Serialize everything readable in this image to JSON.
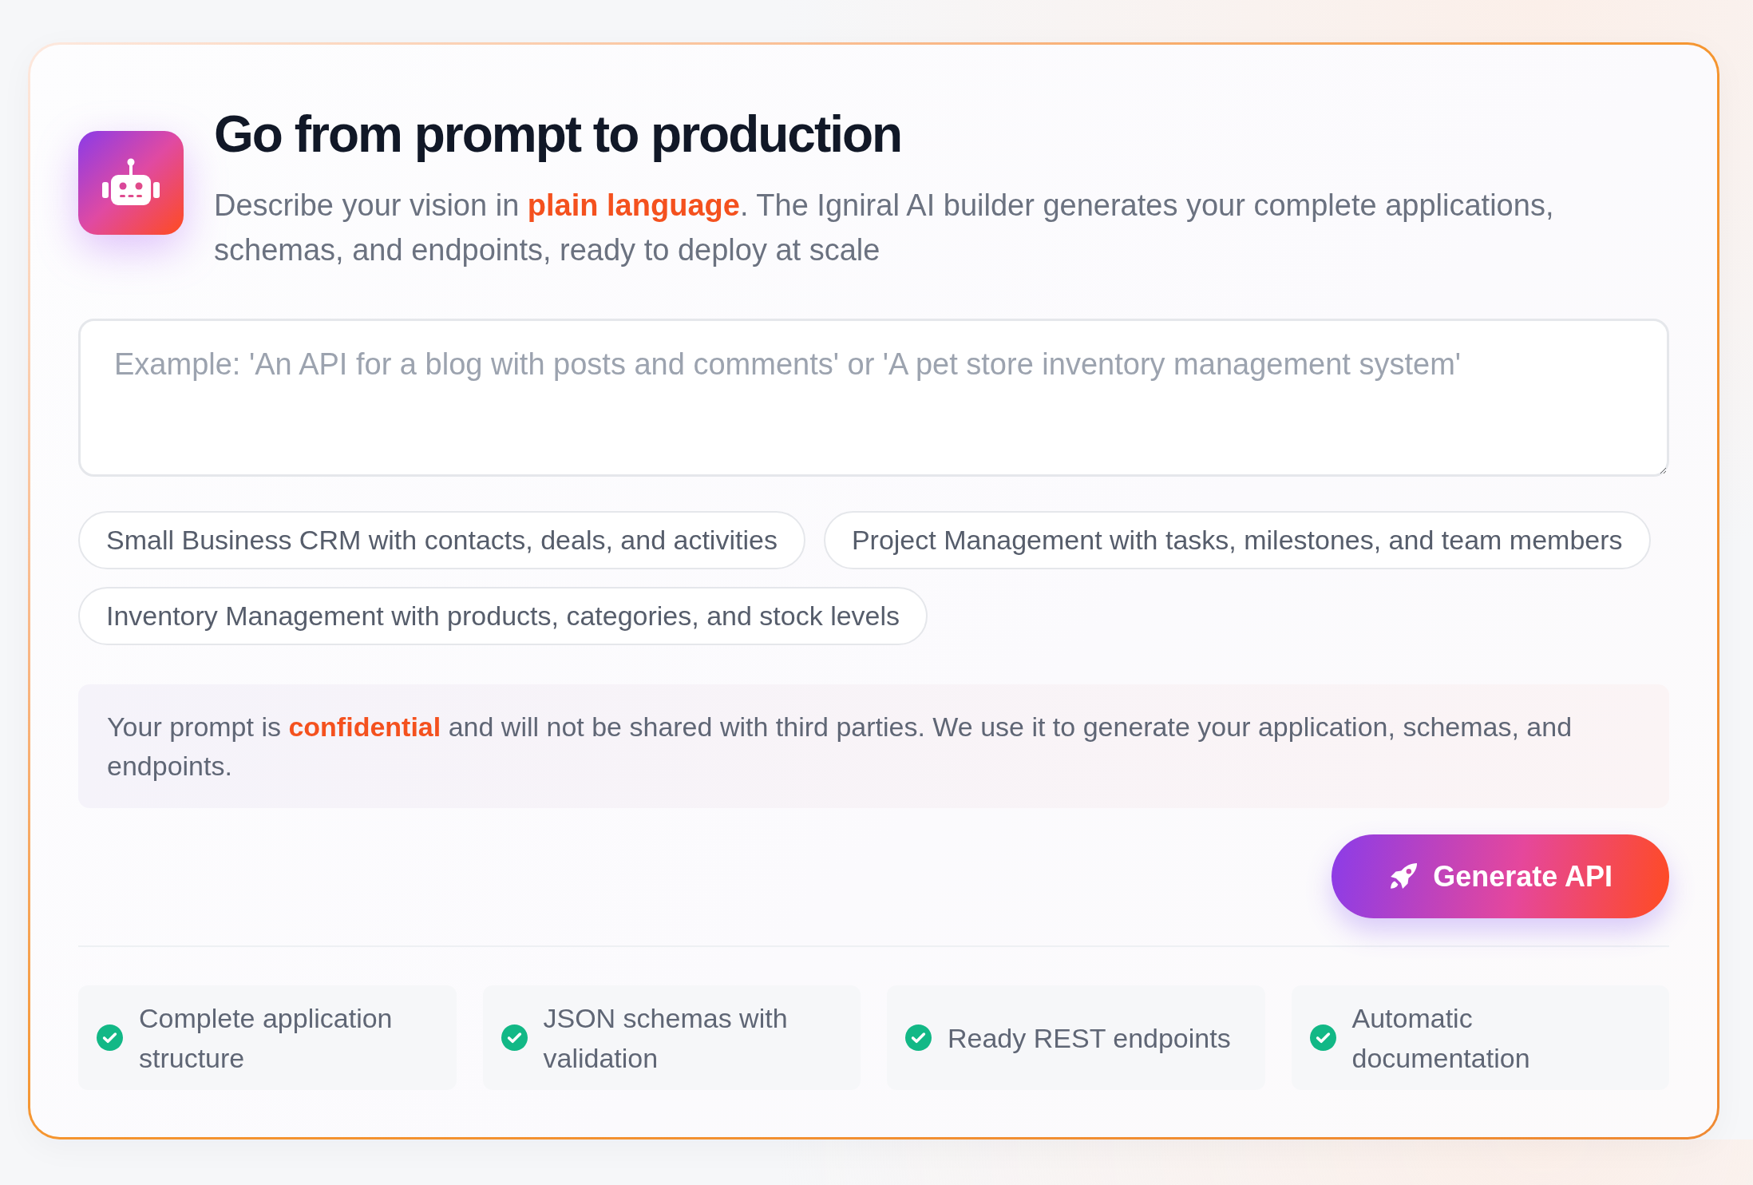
{
  "header": {
    "title": "Go from prompt to production",
    "description": "Describe your vision in **plain language**. The Igniral AI builder generates your complete applications, schemas, and endpoints, ready to deploy at scale"
  },
  "prompt": {
    "placeholder": "Example: 'An API for a blog with posts and comments' or 'A pet store inventory management system'"
  },
  "suggestions": [
    "Small Business CRM with contacts, deals, and activities",
    "Project Management with tasks, milestones, and team members",
    "Inventory Management with products, categories, and stock levels"
  ],
  "notice": {
    "text": "Your prompt is **confidential** and will not be shared with third parties. We use it to generate your application, schemas, and endpoints."
  },
  "generate_button": {
    "label": "Generate API"
  },
  "features": [
    "Complete application structure",
    "JSON schemas with validation",
    "Ready REST endpoints",
    "Automatic documentation"
  ]
}
